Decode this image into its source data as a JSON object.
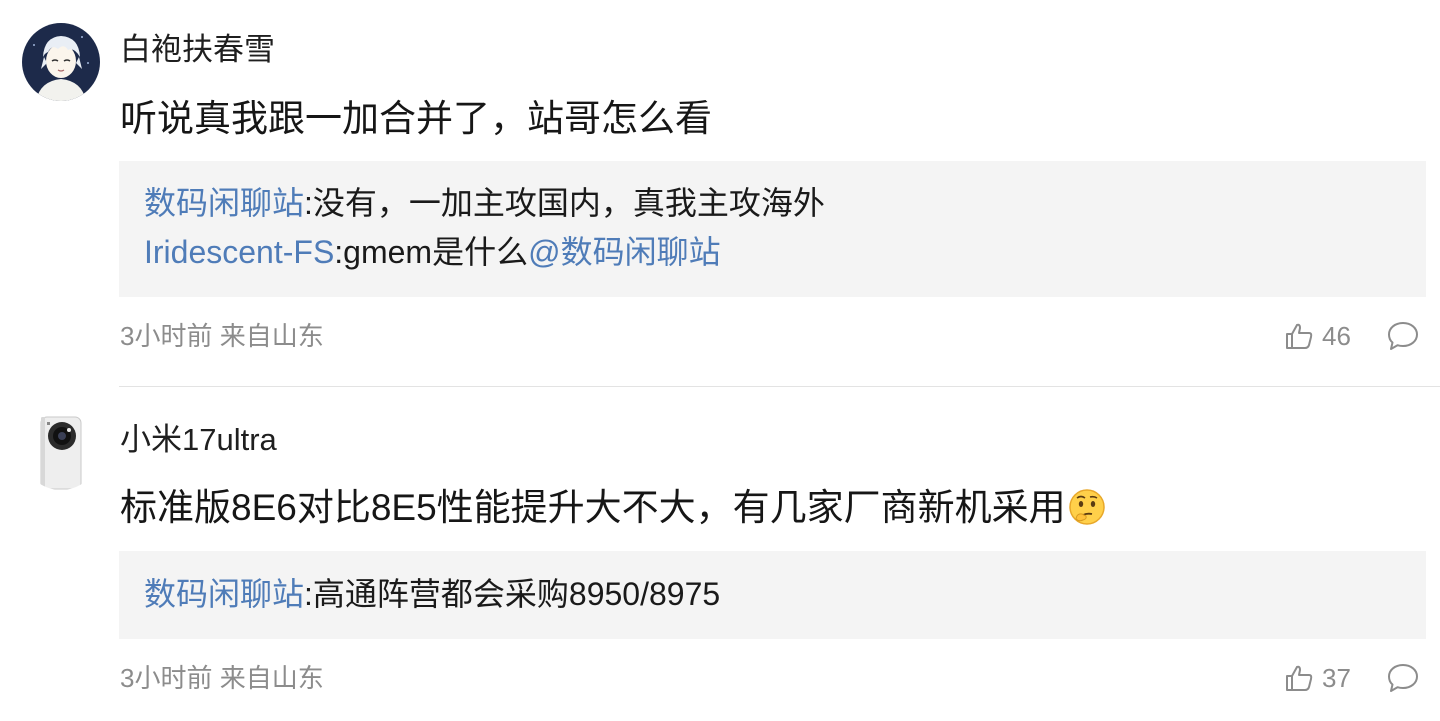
{
  "comments": [
    {
      "username": "白袍扶春雪",
      "avatar_icon": "anime-boy-avatar",
      "content": "听说真我跟一加合并了，站哥怎么看",
      "replies": [
        {
          "author": "数码闲聊站",
          "separator": ":",
          "text": "没有，一加主攻国内，真我主攻海外",
          "mention": ""
        },
        {
          "author": "Iridescent-FS",
          "separator": ":",
          "text": "gmem是什么",
          "mention": "@数码闲聊站"
        }
      ],
      "time": "3小时前",
      "location": "来自山东",
      "likes": "46"
    },
    {
      "username": "小米17ultra",
      "avatar_icon": "phone-camera-avatar",
      "content": "标准版8E6对比8E5性能提升大不大，有几家厂商新机采用",
      "emoji": "thinking-face-emoji",
      "replies": [
        {
          "author": "数码闲聊站",
          "separator": ":",
          "text": "高通阵营都会采购8950/8975",
          "mention": ""
        }
      ],
      "time": "3小时前",
      "location": "来自山东",
      "likes": "37"
    }
  ],
  "colors": {
    "link": "#4f7cb8",
    "meta": "#8c8c8c",
    "reply_bg": "#f4f4f4"
  },
  "icons": {
    "like": "thumbs-up-icon",
    "comment": "comment-bubble-icon"
  }
}
